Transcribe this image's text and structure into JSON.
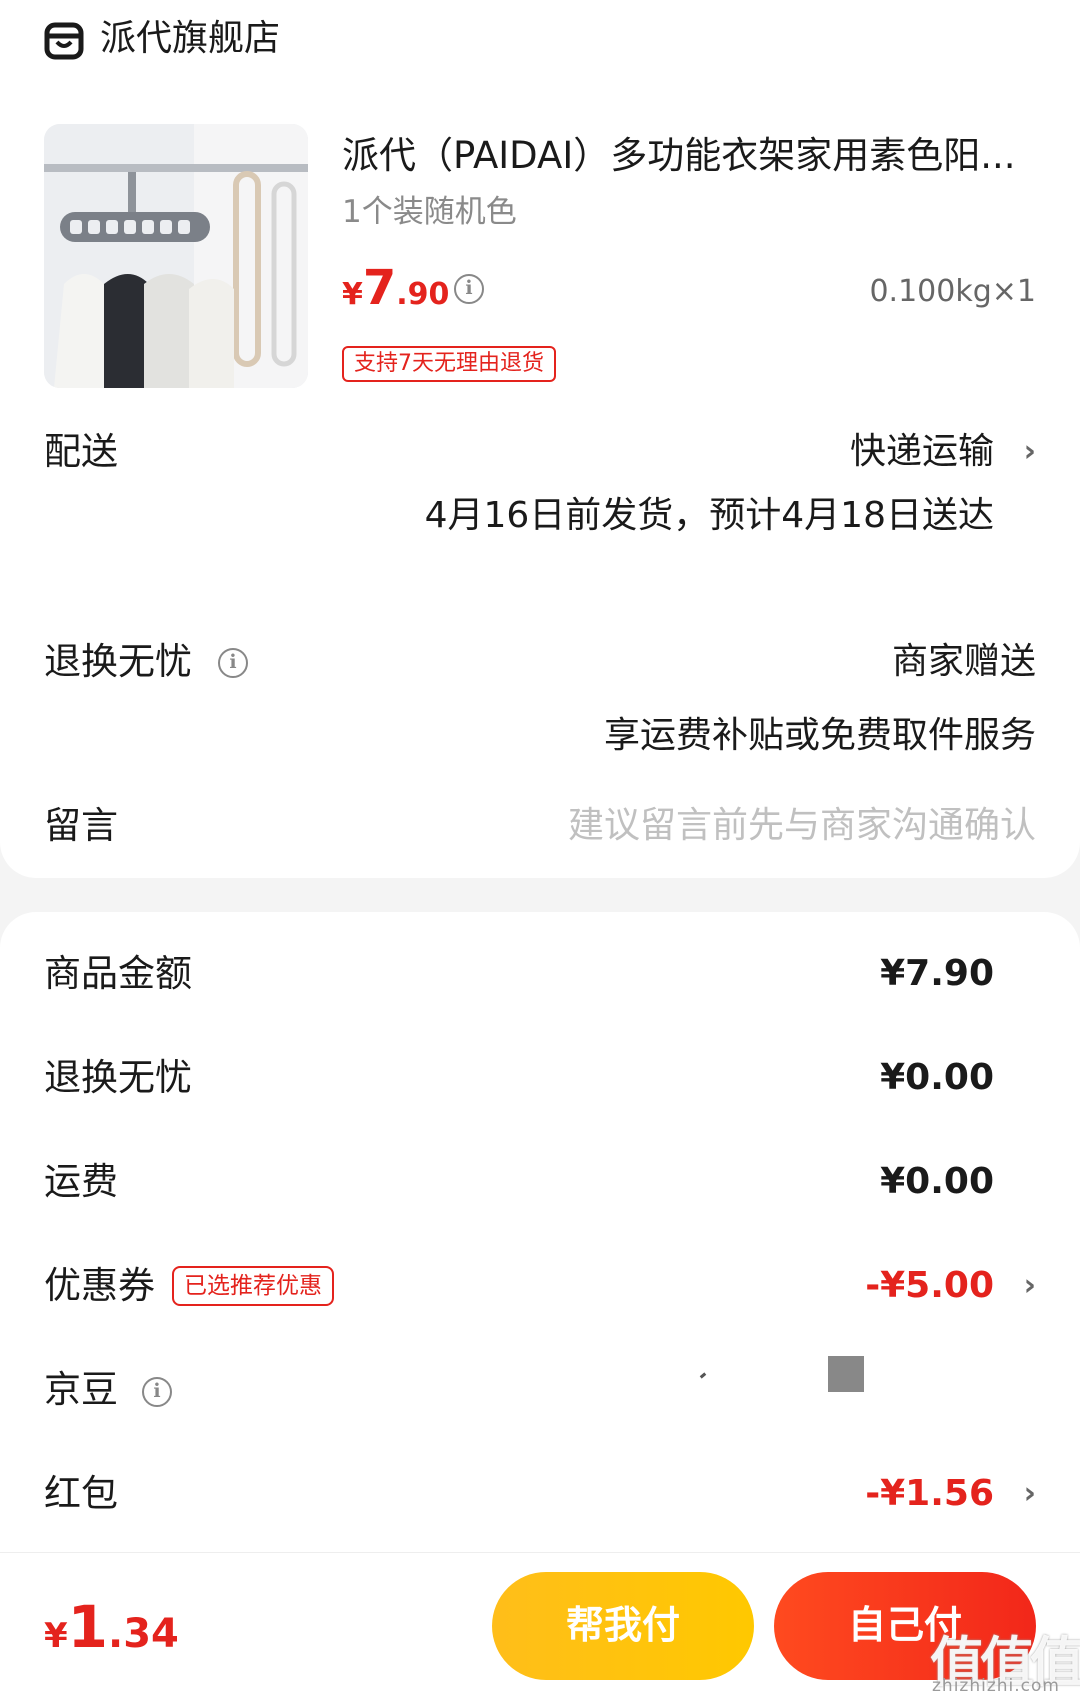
{
  "store": {
    "icon": "store-icon",
    "name": "派代旗舰店"
  },
  "product": {
    "title": "派代（PAIDAI）多功能衣架家用素色阳...",
    "spec": "1个装随机色",
    "price_currency": "¥",
    "price_int": "7",
    "price_dec": ".90",
    "quantity": "0.100kg×1",
    "return_badge": "支持7天无理由退货"
  },
  "delivery": {
    "label": "配送",
    "method": "快递运输",
    "schedule": "4月16日前发货，预计4月18日送达"
  },
  "return_service": {
    "label": "退换无忧",
    "value": "商家赠送",
    "detail": "享运费补贴或免费取件服务"
  },
  "message": {
    "label": "留言",
    "placeholder": "建议留言前先与商家沟通确认"
  },
  "summary": {
    "goods_label": "商品金额",
    "goods_value": "¥7.90",
    "return_label": "退换无忧",
    "return_value": "¥0.00",
    "shipping_label": "运费",
    "shipping_value": "¥0.00",
    "coupon_label": "优惠券",
    "coupon_tag": "已选推荐优惠",
    "coupon_value": "-¥5.00",
    "jingdou_label": "京豆",
    "redpacket_label": "红包",
    "redpacket_value": "-¥1.56"
  },
  "footer": {
    "total_currency": "¥",
    "total_int": "1",
    "total_dec": ".34",
    "help_pay": "帮我付",
    "self_pay": "自己付"
  },
  "watermark": {
    "main": "值值值",
    "sub": "zhizhizhi.com"
  },
  "colors": {
    "accent": "#e4231d",
    "help_button": "#ffc107",
    "self_button": "#f2271a"
  }
}
